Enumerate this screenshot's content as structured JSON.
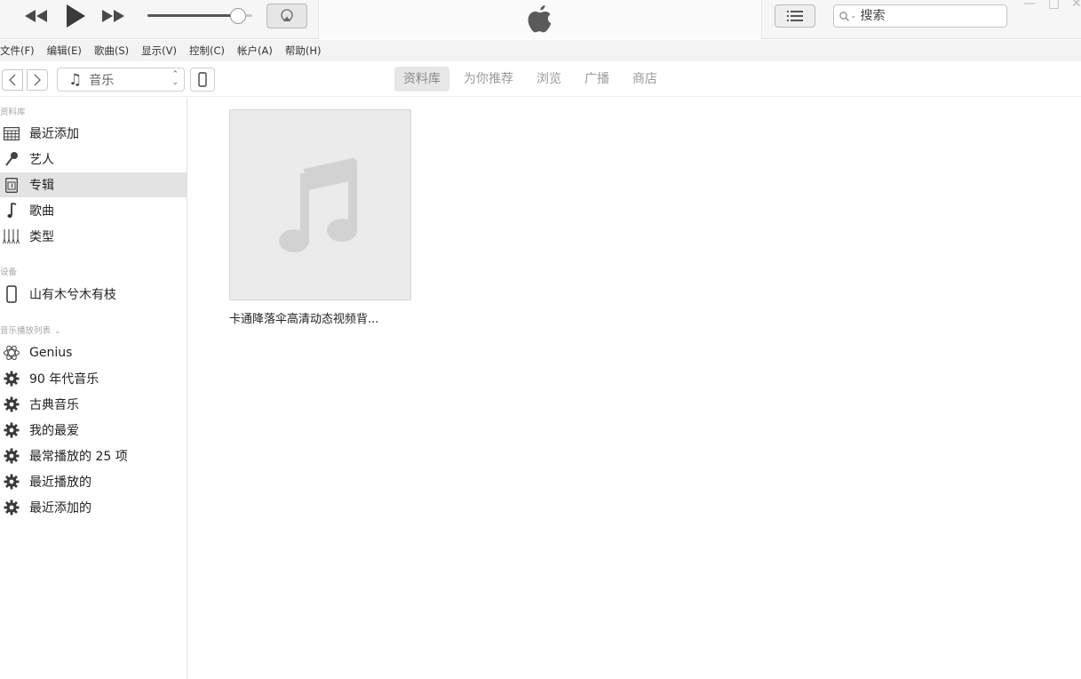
{
  "player": {
    "volume_level": 0.9,
    "search": {
      "placeholder": "搜索"
    }
  },
  "menu": {
    "items": [
      "文件(F)",
      "编辑(E)",
      "歌曲(S)",
      "显示(V)",
      "控制(C)",
      "帐户(A)",
      "帮助(H)"
    ]
  },
  "nav": {
    "media_type": "音乐",
    "tabs": [
      {
        "label": "资料库",
        "active": true
      },
      {
        "label": "为你推荐",
        "active": false
      },
      {
        "label": "浏览",
        "active": false
      },
      {
        "label": "广播",
        "active": false
      },
      {
        "label": "商店",
        "active": false
      }
    ]
  },
  "sidebar": {
    "library_heading": "资料库",
    "library": [
      {
        "label": "最近添加",
        "icon": "calendar-grid-icon"
      },
      {
        "label": "艺人",
        "icon": "microphone-icon"
      },
      {
        "label": "专辑",
        "icon": "album-icon",
        "selected": true
      },
      {
        "label": "歌曲",
        "icon": "music-note-icon"
      },
      {
        "label": "类型",
        "icon": "genre-icon"
      }
    ],
    "devices_heading": "设备",
    "devices": [
      {
        "label": "山有木兮木有枝",
        "icon": "phone-icon"
      }
    ],
    "playlists_heading": "音乐播放列表",
    "playlists": [
      {
        "label": "Genius",
        "icon": "genius-atom-icon"
      },
      {
        "label": "90 年代音乐",
        "icon": "smart-playlist-gear-icon"
      },
      {
        "label": "古典音乐",
        "icon": "smart-playlist-gear-icon"
      },
      {
        "label": "我的最爱",
        "icon": "smart-playlist-gear-icon"
      },
      {
        "label": "最常播放的 25 项",
        "icon": "smart-playlist-gear-icon"
      },
      {
        "label": "最近播放的",
        "icon": "smart-playlist-gear-icon"
      },
      {
        "label": "最近添加的",
        "icon": "smart-playlist-gear-icon"
      }
    ]
  },
  "main": {
    "albums": [
      {
        "title": "卡通降落伞高清动态视频背..."
      }
    ]
  },
  "colors": {
    "toolbar_bg": "#f6f6f6",
    "selected_row": "#e3e3e3",
    "active_tab": "#e7e7e7",
    "artwork_bg": "#ebebeb"
  }
}
